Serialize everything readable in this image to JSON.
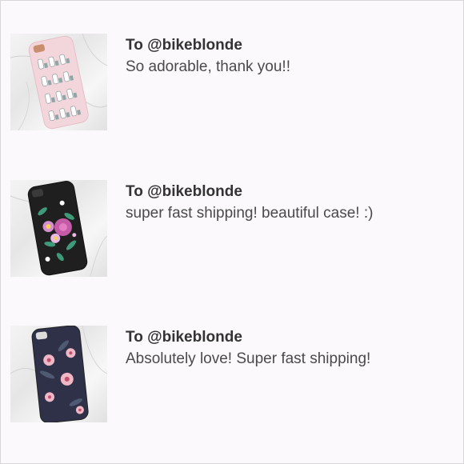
{
  "reviews": [
    {
      "recipient": "To @bikeblonde",
      "message": "So adorable, thank you!!",
      "photo_icon": "pink-llama-phone-case-photo",
      "case_color": "#f3d6dc"
    },
    {
      "recipient": "To @bikeblonde",
      "message": "super fast shipping! beautiful case! :)",
      "photo_icon": "black-floral-embroidery-phone-case-photo",
      "case_color": "#1f1f1f"
    },
    {
      "recipient": "To @bikeblonde",
      "message": "Absolutely love! Super fast shipping!",
      "photo_icon": "navy-floral-phone-case-photo",
      "case_color": "#2f3148"
    }
  ]
}
